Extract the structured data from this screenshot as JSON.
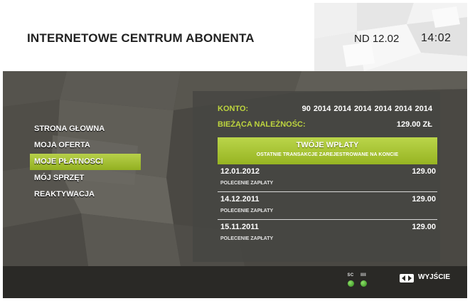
{
  "header": {
    "title": "INTERNETOWE CENTRUM ABONENTA",
    "date": "ND 12.02",
    "time": "14:02"
  },
  "menu": {
    "items": [
      {
        "label": "STRONA GŁOWNA",
        "active": false
      },
      {
        "label": "MOJA OFERTA",
        "active": false
      },
      {
        "label": "MOJE PŁATNOSCI",
        "active": true
      },
      {
        "label": "MÓJ SPRZĘT",
        "active": false
      },
      {
        "label": "REAKTYWACJA",
        "active": false
      }
    ]
  },
  "account": {
    "label": "KONTO:",
    "number": "90 2014 2014 2014  2014 2014 2014"
  },
  "balance": {
    "label": "BIEŻĄCA NALEŻNOŚC:",
    "value": "129.00 ZŁ"
  },
  "payments_banner": {
    "title": "TWÓJE WPŁATY",
    "subtitle": "OSTATNIE TRANSAKCJE ZAREJESTROWANE NA KONCIE"
  },
  "transactions": [
    {
      "date": "12.01.2012",
      "amount": "129.00",
      "type": "POLECENIE ZAPŁATY"
    },
    {
      "date": "14.12.2011",
      "amount": "129.00",
      "type": "POLECENIE ZAPŁATY"
    },
    {
      "date": "15.11.2011",
      "amount": "129.00",
      "type": "POLECENIE ZAPŁATY"
    }
  ],
  "footer": {
    "indicator_sc": "SC",
    "indicator_bars": "IIII",
    "exit_label": "WYJŚCIE"
  },
  "colors": {
    "accent_green": "#a4c132",
    "label_green": "#bdd43e",
    "footer_bg": "#2a2926"
  },
  "icons": {
    "exit": "exit-arrows-icon",
    "signal": "status-led-icon"
  }
}
